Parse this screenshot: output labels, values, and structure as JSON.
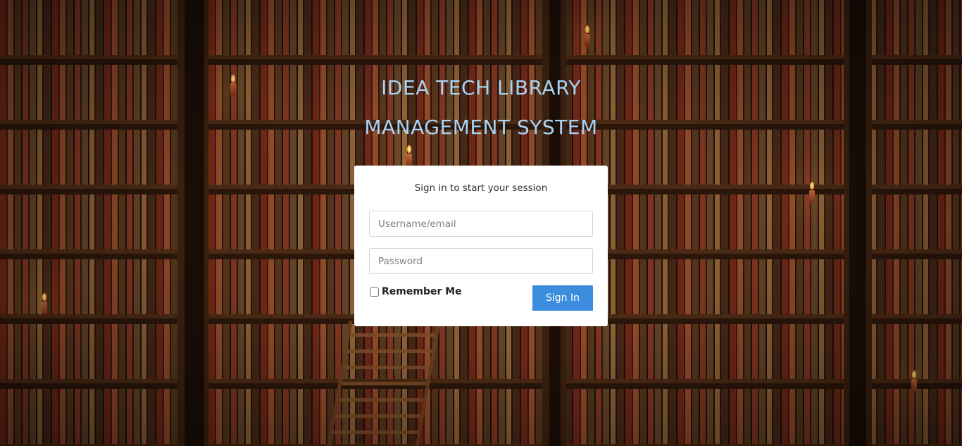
{
  "header": {
    "title_line1": "IDEA TECH LIBRARY",
    "title_line2": "MANAGEMENT SYSTEM"
  },
  "login": {
    "message": "Sign in to start your session",
    "username_placeholder": "Username/email",
    "username_value": "",
    "password_placeholder": "Password",
    "password_value": "",
    "remember_label": "Remember Me",
    "remember_checked": false,
    "submit_label": "Sign In"
  },
  "colors": {
    "title": "#a9d3f5",
    "button": "#3c8dde"
  }
}
